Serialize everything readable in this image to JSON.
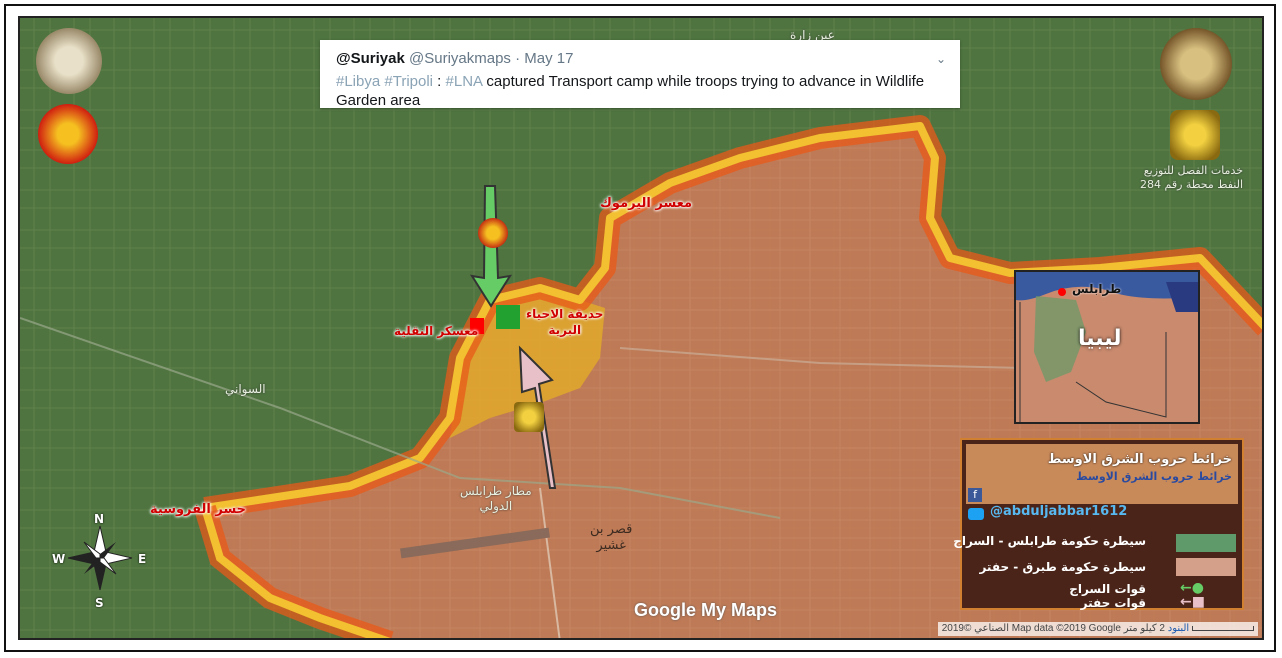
{
  "tweet": {
    "display_name": "@Suriyak",
    "handle_date": "@Suriyakmaps · May 17",
    "tags": "#Libya #Tripoli",
    "text_a": ":",
    "tag_lna": "#LNA",
    "text_b": "captured Transport camp while troops trying to advance in Wildlife Garden area"
  },
  "labels": {
    "yarmouk_camp": "معسر اليرموك",
    "wildlife_garden": "حديقة الاحياء\nالبرية",
    "transport_camp": "معسكر النقلية",
    "furusiya_bridge": "جسر الفروسية",
    "tripoli_airport": "مطار طرابلس\nالدولي",
    "qasr_bin_ghashir": "قصر بن\nغشير",
    "al_swani": "السواني",
    "ain_zara": "عين زارة",
    "top_right_place": "خدمات الفصل للتوزيع\nالنفط محطة رقم 284",
    "inset_city": "طرابلس",
    "inset_country": "ليبيا"
  },
  "legend": {
    "banner_title": "خرائط حروب الشرق الاوسط",
    "banner_sub": "خرائط حروب الشرق الاوسط",
    "twitter_handle": "@abduljabbar1612",
    "row1": "سيطرة حكومة طرابلس - السراج",
    "row2": "سيطرة حكومة طبرق - حفتر",
    "row3": "قوات السراج",
    "row4": "قوات حفتر",
    "colors": {
      "gna": "#5f9b6a",
      "lna": "#d4a089",
      "arrow_gna": "#66cc66",
      "arrow_lna": "#e8c0c8"
    }
  },
  "compass": {
    "n": "N",
    "s": "S",
    "e": "E",
    "w": "W"
  },
  "google": {
    "logo": "Google My Maps"
  },
  "credits": {
    "text": "الصناعي ©2019 Map data ©2019 Google",
    "terms": "البنود",
    "scale": "2 كيلو متر"
  },
  "colors": {
    "frontline_outer": "#e85a1a",
    "frontline_inner": "#f2c030",
    "lna_fill": "#c8704a",
    "gna_fill": "#4e7a3e",
    "garden_zone": "#e0a82a"
  }
}
